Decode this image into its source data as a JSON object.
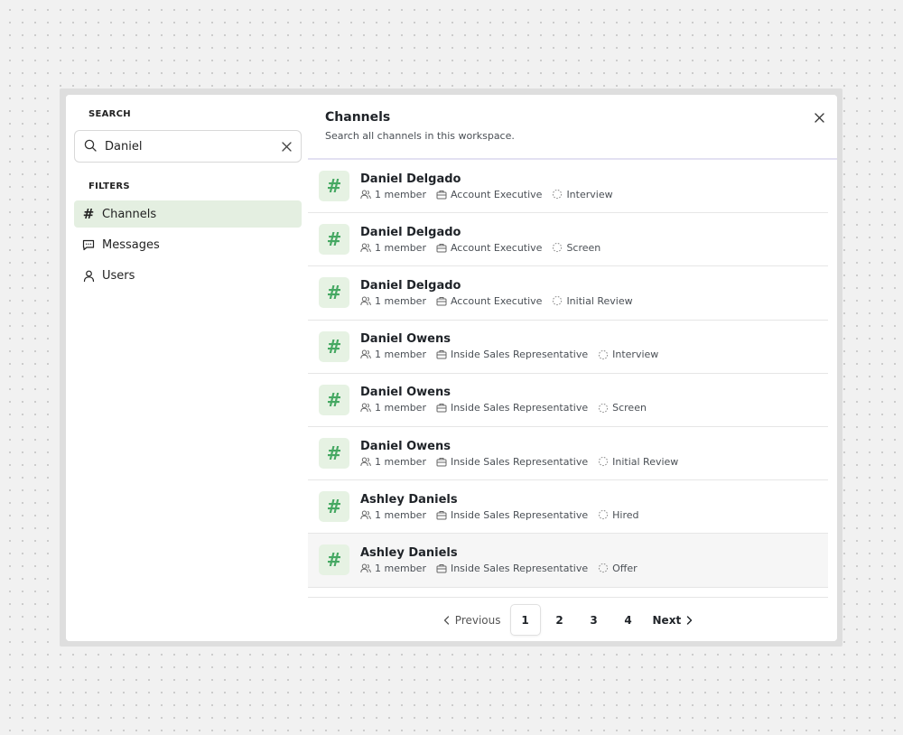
{
  "sidebar": {
    "search_label": "SEARCH",
    "search_value": "Daniel",
    "filters_label": "FILTERS",
    "filters": [
      {
        "label": "Channels",
        "icon": "hash-icon",
        "active": true
      },
      {
        "label": "Messages",
        "icon": "message-square-icon",
        "active": false
      },
      {
        "label": "Users",
        "icon": "user-icon",
        "active": false
      }
    ]
  },
  "main": {
    "title": "Channels",
    "subtitle": "Search all channels in this workspace.",
    "results": [
      {
        "name": "Daniel Delgado",
        "members": "1 member",
        "role": "Account Executive",
        "stage": "Interview"
      },
      {
        "name": "Daniel Delgado",
        "members": "1 member",
        "role": "Account Executive",
        "stage": "Screen"
      },
      {
        "name": "Daniel Delgado",
        "members": "1 member",
        "role": "Account Executive",
        "stage": "Initial Review"
      },
      {
        "name": "Daniel Owens",
        "members": "1 member",
        "role": "Inside Sales Representative",
        "stage": "Interview"
      },
      {
        "name": "Daniel Owens",
        "members": "1 member",
        "role": "Inside Sales Representative",
        "stage": "Screen"
      },
      {
        "name": "Daniel Owens",
        "members": "1 member",
        "role": "Inside Sales Representative",
        "stage": "Initial Review"
      },
      {
        "name": "Ashley Daniels",
        "members": "1 member",
        "role": "Inside Sales Representative",
        "stage": "Hired"
      },
      {
        "name": "Ashley Daniels",
        "members": "1 member",
        "role": "Inside Sales Representative",
        "stage": "Offer"
      }
    ],
    "pagination": {
      "previous": "Previous",
      "next": "Next",
      "pages": [
        "1",
        "2",
        "3",
        "4"
      ],
      "current": "1"
    }
  },
  "colors": {
    "accent_green": "#45a862",
    "tile_bg": "#e6f2e3",
    "active_filter_bg": "#e4efe1",
    "header_divider": "#e3e1f2"
  }
}
